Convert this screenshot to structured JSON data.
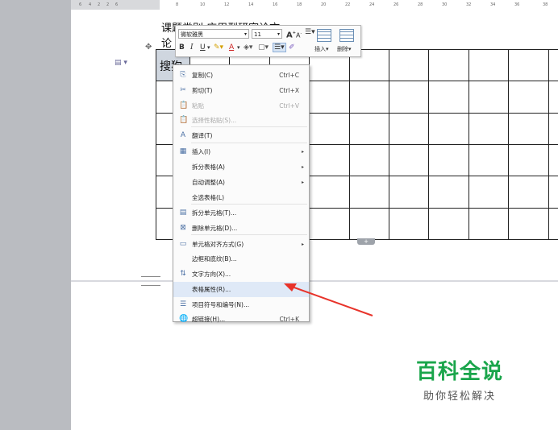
{
  "ruler": {
    "ticks": [
      "6",
      "4",
      "2",
      "2",
      "6",
      "8",
      "10",
      "12",
      "14",
      "16",
      "18",
      "20",
      "22",
      "24",
      "26",
      "28",
      "30",
      "32",
      "34",
      "36",
      "38"
    ]
  },
  "document": {
    "line1": "课题类别   应用型研究论文",
    "line2": "论",
    "cell_text": "搜狗"
  },
  "mini_toolbar": {
    "font_name": "微软雅黑",
    "font_size": "11",
    "grow_font": "A",
    "shrink_font": "A",
    "bold": "B",
    "italic": "I",
    "underline": "U",
    "font_color": "A",
    "insert_label": "插入",
    "delete_label": "删除"
  },
  "context_menu": {
    "items": [
      {
        "label": "复制(C)",
        "shortcut": "Ctrl+C",
        "icon": "copy-icon",
        "glyph": "⎘"
      },
      {
        "label": "剪切(T)",
        "shortcut": "Ctrl+X",
        "icon": "scissors-icon",
        "glyph": "✂"
      },
      {
        "label": "粘贴",
        "shortcut": "Ctrl+V",
        "icon": "paste-icon",
        "glyph": "📋"
      },
      {
        "label": "选择性粘贴(S)...",
        "shortcut": "",
        "icon": "paste-special-icon",
        "glyph": "📋"
      },
      {
        "label": "翻译(T)",
        "shortcut": "",
        "icon": "translate-icon",
        "glyph": "A"
      },
      {
        "label": "插入(I)",
        "shortcut": "",
        "icon": "table-insert-icon",
        "glyph": "▦"
      },
      {
        "label": "拆分表格(A)",
        "shortcut": "",
        "icon": "",
        "glyph": ""
      },
      {
        "label": "自动调整(A)",
        "shortcut": "",
        "icon": "",
        "glyph": ""
      },
      {
        "label": "全选表格(L)",
        "shortcut": "",
        "icon": "",
        "glyph": ""
      },
      {
        "label": "拆分单元格(T)...",
        "shortcut": "",
        "icon": "split-cells-icon",
        "glyph": "▤"
      },
      {
        "label": "删除单元格(D)...",
        "shortcut": "",
        "icon": "delete-cells-icon",
        "glyph": "⊠"
      },
      {
        "label": "单元格对齐方式(G)",
        "shortcut": "",
        "icon": "cell-align-icon",
        "glyph": "▭"
      },
      {
        "label": "边框和底纹(B)...",
        "shortcut": "",
        "icon": "",
        "glyph": ""
      },
      {
        "label": "文字方向(X)...",
        "shortcut": "",
        "icon": "text-direction-icon",
        "glyph": "⇅"
      },
      {
        "label": "表格属性(R)...",
        "shortcut": "",
        "icon": "",
        "glyph": ""
      },
      {
        "label": "项目符号和编号(N)...",
        "shortcut": "",
        "icon": "bullet-list-icon",
        "glyph": "☰"
      },
      {
        "label": "超链接(H)...",
        "shortcut": "Ctrl+K",
        "icon": "hyperlink-icon",
        "glyph": "🌐"
      }
    ]
  },
  "watermark": {
    "title": "百科全说",
    "subtitle": "助你轻松解决"
  },
  "colors": {
    "watermark_green": "#1aa54b",
    "arrow_red": "#e8332a",
    "menu_highlight": "#dfe9f7"
  }
}
